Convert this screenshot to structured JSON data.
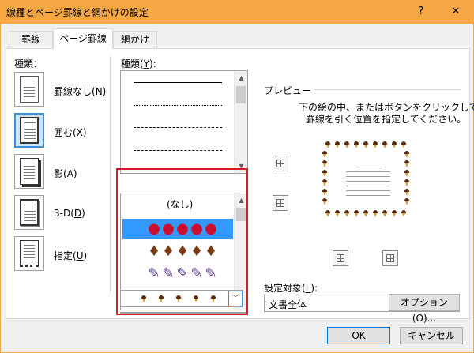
{
  "window": {
    "title": "線種とページ罫線と網かけの設定",
    "help_label": "?",
    "close_label": "✕"
  },
  "tabs": [
    {
      "label": "罫線",
      "active": false
    },
    {
      "label": "ページ罫線",
      "active": true
    },
    {
      "label": "網かけ",
      "active": false
    }
  ],
  "setting": {
    "label": "種類：",
    "items": [
      {
        "label": "罫線なし(",
        "key": "N",
        "suffix": ")",
        "selected": false,
        "icon": "no-border-icon"
      },
      {
        "label": "囲む(",
        "key": "X",
        "suffix": ")",
        "selected": true,
        "icon": "box-border-icon"
      },
      {
        "label": "影(",
        "key": "A",
        "suffix": ")",
        "selected": false,
        "icon": "shadow-border-icon"
      },
      {
        "label": "3-D(",
        "key": "D",
        "suffix": ")",
        "selected": false,
        "icon": "3d-border-icon"
      },
      {
        "label": "指定(",
        "key": "U",
        "suffix": ")",
        "selected": false,
        "icon": "custom-border-icon"
      }
    ]
  },
  "style": {
    "label": "種類(",
    "key": "Y",
    "suffix": "):"
  },
  "art": {
    "none_label": "(なし)",
    "items": [
      "strawberry-art",
      "ice-cream-art",
      "pencil-art",
      "leaf-art"
    ],
    "selected_index": 0,
    "combo_selected": "ice-cream-cone-art"
  },
  "preview": {
    "label": "プレビュー",
    "instructions_line1": "下の絵の中、またはボタンをクリックして、",
    "instructions_line2": "罫線を引く位置を指定してください。"
  },
  "apply_to": {
    "label": "設定対象(",
    "key": "L",
    "suffix": "):",
    "value": "文書全体"
  },
  "buttons": {
    "options": "オプション(O)...",
    "ok": "OK",
    "cancel": "キャンセル"
  },
  "colors": {
    "title_bar": "#f4a742",
    "selection": "#3399ff",
    "highlight_box": "#d01e2b"
  }
}
